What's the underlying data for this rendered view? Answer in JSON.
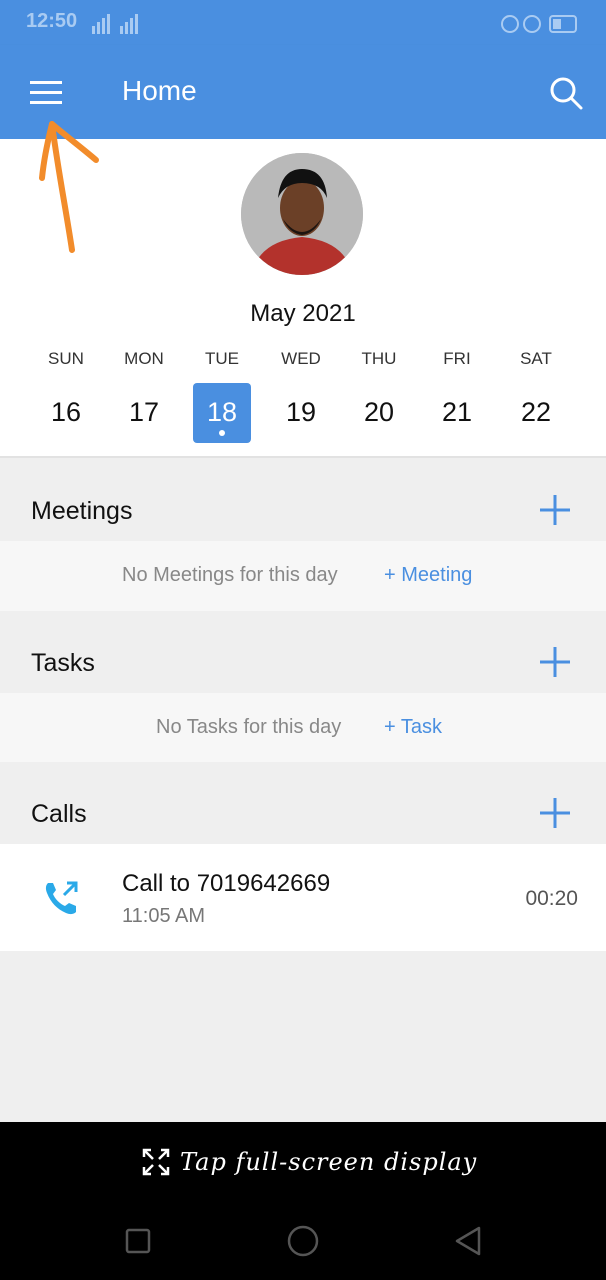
{
  "status_bar": {
    "time": "12:50"
  },
  "app_bar": {
    "title": "Home"
  },
  "calendar": {
    "month": "May 2021",
    "days": [
      {
        "name": "SUN",
        "num": "16"
      },
      {
        "name": "MON",
        "num": "17"
      },
      {
        "name": "TUE",
        "num": "18"
      },
      {
        "name": "WED",
        "num": "19"
      },
      {
        "name": "THU",
        "num": "20"
      },
      {
        "name": "FRI",
        "num": "21"
      },
      {
        "name": "SAT",
        "num": "22"
      }
    ],
    "selected_day": "18"
  },
  "meetings": {
    "title": "Meetings",
    "empty_text": "No Meetings for this day",
    "add_label": "+ Meeting"
  },
  "tasks": {
    "title": "Tasks",
    "empty_text": "No Tasks for this day",
    "add_label": "+ Task"
  },
  "calls": {
    "title": "Calls",
    "items": [
      {
        "title": "Call to 7019642669",
        "time": "11:05 AM",
        "duration": "00:20"
      }
    ]
  },
  "overlay": {
    "hint": "Tap full-screen display"
  },
  "colors": {
    "accent": "#4a8fe0",
    "annotation": "#f28c2b",
    "call_icon": "#2aa9e8"
  }
}
